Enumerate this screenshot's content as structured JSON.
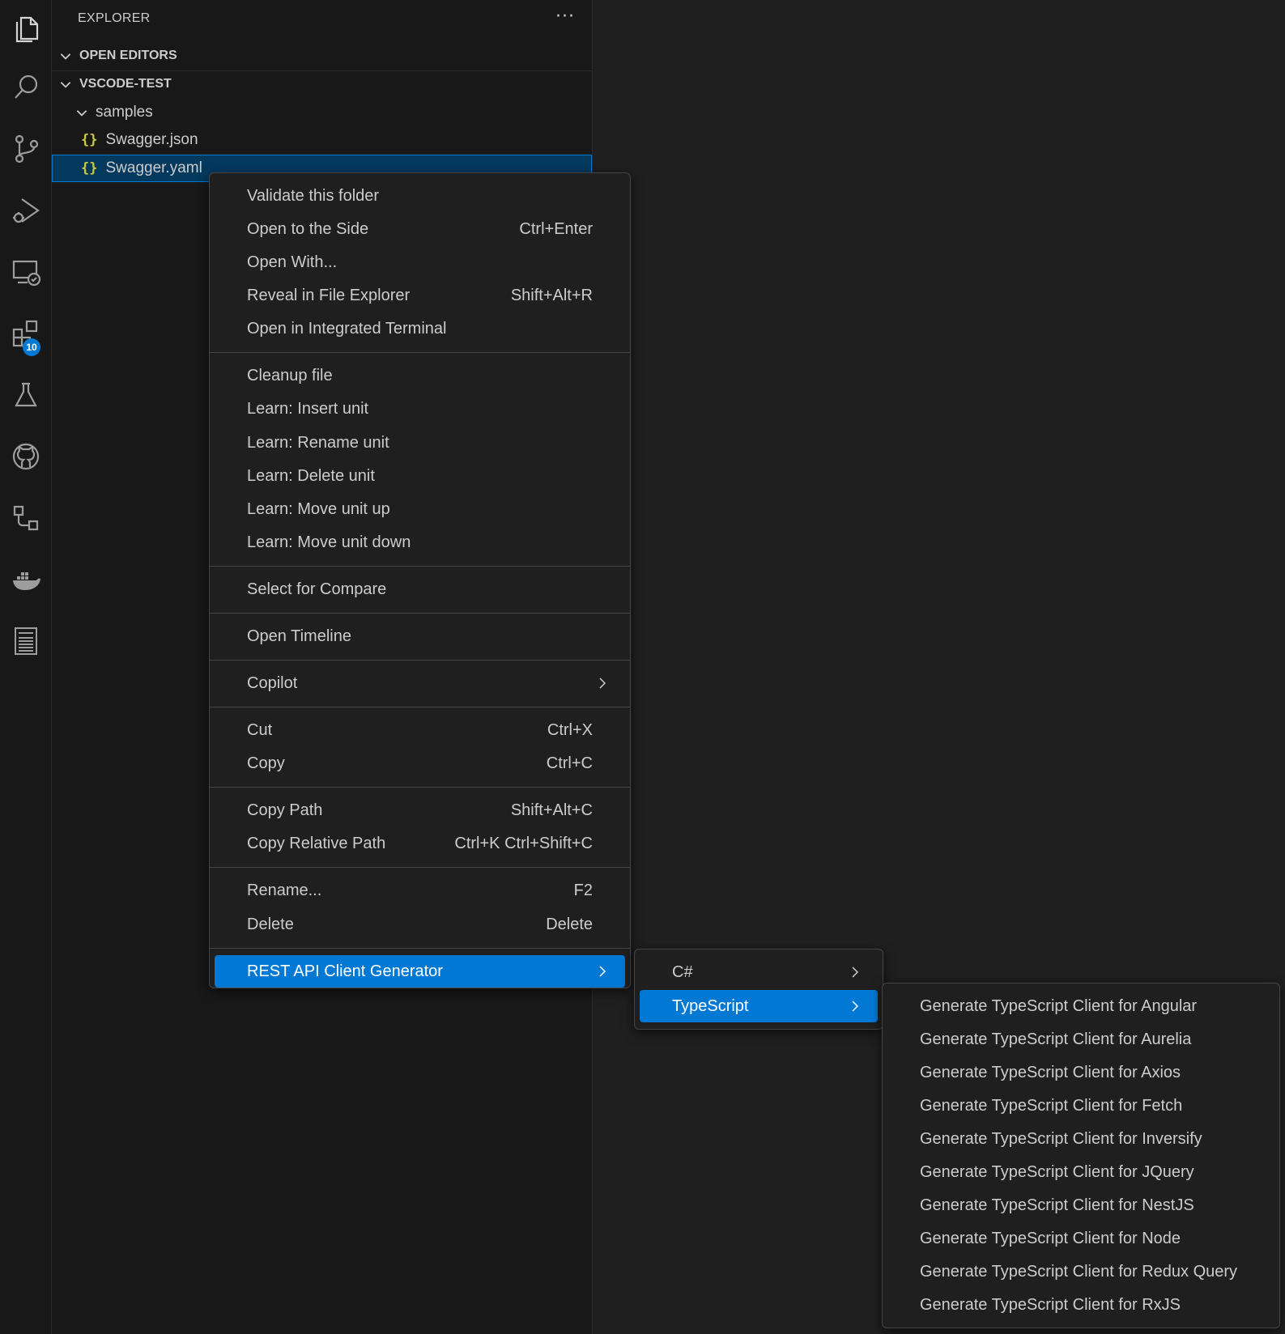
{
  "activity_bar": {
    "icons": [
      "explorer-icon",
      "search-icon",
      "source-control-icon",
      "run-debug-icon",
      "remote-explorer-icon",
      "extensions-icon",
      "testing-icon",
      "github-icon",
      "workflow-icon",
      "docker-icon",
      "notebook-icon"
    ],
    "extensions_badge": "10",
    "accent": "#0078d4"
  },
  "sidebar": {
    "title": "EXPLORER",
    "more": "···",
    "open_editors": "OPEN EDITORS",
    "workspace": "VSCODE-TEST",
    "folder": "samples",
    "files": [
      {
        "name": "Swagger.json",
        "icon": "{}"
      },
      {
        "name": "Swagger.yaml",
        "icon": "{}"
      }
    ]
  },
  "context_menu": {
    "groups": [
      [
        {
          "label": "Validate this folder",
          "kb": ""
        },
        {
          "label": "Open to the Side",
          "kb": "Ctrl+Enter"
        },
        {
          "label": "Open With...",
          "kb": ""
        },
        {
          "label": "Reveal in File Explorer",
          "kb": "Shift+Alt+R"
        },
        {
          "label": "Open in Integrated Terminal",
          "kb": ""
        }
      ],
      [
        {
          "label": "Cleanup file",
          "kb": ""
        },
        {
          "label": "Learn: Insert unit",
          "kb": ""
        },
        {
          "label": "Learn: Rename unit",
          "kb": ""
        },
        {
          "label": "Learn: Delete unit",
          "kb": ""
        },
        {
          "label": "Learn: Move unit up",
          "kb": ""
        },
        {
          "label": "Learn: Move unit down",
          "kb": ""
        }
      ],
      [
        {
          "label": "Select for Compare",
          "kb": ""
        }
      ],
      [
        {
          "label": "Open Timeline",
          "kb": ""
        }
      ],
      [
        {
          "label": "Copilot",
          "kb": "",
          "submenu": true
        }
      ],
      [
        {
          "label": "Cut",
          "kb": "Ctrl+X"
        },
        {
          "label": "Copy",
          "kb": "Ctrl+C"
        }
      ],
      [
        {
          "label": "Copy Path",
          "kb": "Shift+Alt+C"
        },
        {
          "label": "Copy Relative Path",
          "kb": "Ctrl+K Ctrl+Shift+C"
        }
      ],
      [
        {
          "label": "Rename...",
          "kb": "F2"
        },
        {
          "label": "Delete",
          "kb": "Delete"
        }
      ],
      [
        {
          "label": "REST API Client Generator",
          "kb": "",
          "submenu": true,
          "active": true
        }
      ]
    ]
  },
  "submenu_language": [
    {
      "label": "C#",
      "active": false
    },
    {
      "label": "TypeScript",
      "active": true
    }
  ],
  "submenu_typescript": [
    "Generate TypeScript Client for Angular",
    "Generate TypeScript Client for Aurelia",
    "Generate TypeScript Client for Axios",
    "Generate TypeScript Client for Fetch",
    "Generate TypeScript Client for Inversify",
    "Generate TypeScript Client for JQuery",
    "Generate TypeScript Client for NestJS",
    "Generate TypeScript Client for Node",
    "Generate TypeScript Client for Redux Query",
    "Generate TypeScript Client for RxJS"
  ]
}
